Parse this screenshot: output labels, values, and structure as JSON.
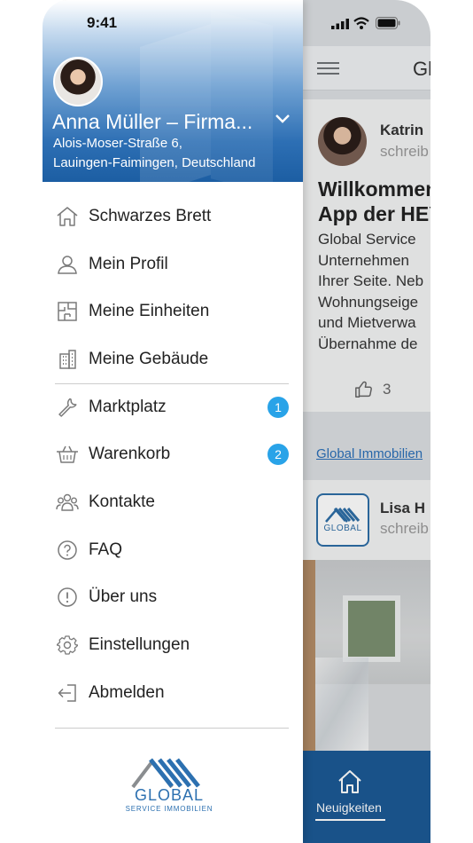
{
  "status_bar": {
    "time": "9:41"
  },
  "drawer": {
    "user": {
      "name": "Anna Müller – Firma...",
      "address_line1": "Alois-Moser-Straße 6,",
      "address_line2": "Lauingen-Faimingen, Deutschland"
    },
    "menu": [
      {
        "label": "Schwarzes Brett",
        "icon": "home-outline-icon"
      },
      {
        "label": "Mein Profil",
        "icon": "person-icon"
      },
      {
        "label": "Meine Einheiten",
        "icon": "floorplan-icon"
      },
      {
        "label": "Meine Gebäude",
        "icon": "building-icon"
      },
      {
        "label": "Marktplatz",
        "icon": "wrench-icon",
        "badge": "1"
      },
      {
        "label": "Warenkorb",
        "icon": "basket-icon",
        "badge": "2"
      },
      {
        "label": "Kontakte",
        "icon": "contacts-icon"
      },
      {
        "label": "FAQ",
        "icon": "question-circle-icon"
      },
      {
        "label": "Über uns",
        "icon": "info-circle-icon"
      },
      {
        "label": "Einstellungen",
        "icon": "gear-icon"
      },
      {
        "label": "Abmelden",
        "icon": "logout-icon"
      }
    ],
    "logo": {
      "word": "GLOBAL",
      "subtitle": "SERVICE IMMOBILIEN"
    }
  },
  "feed": {
    "app_title": "Gl",
    "post1": {
      "author": "Katrin",
      "subtitle": "schreib",
      "title_line1": "Willkommen",
      "title_line2": "App der HEY",
      "body": [
        "Global Service",
        "Unternehmen",
        "Ihrer Seite. Neb",
        "Wohnungseige",
        "und Mietverwa",
        "Übernahme de"
      ],
      "likes": "3"
    },
    "link_text": "Global Immobilien",
    "post2": {
      "author": "Lisa H",
      "subtitle": "schreib",
      "badge_text": "GLOBAL"
    },
    "bottom_nav": {
      "label": "Neuigkeiten"
    }
  },
  "colors": {
    "accent": "#1c5a95",
    "badge": "#29a3e8",
    "link": "#2a6fb8"
  }
}
